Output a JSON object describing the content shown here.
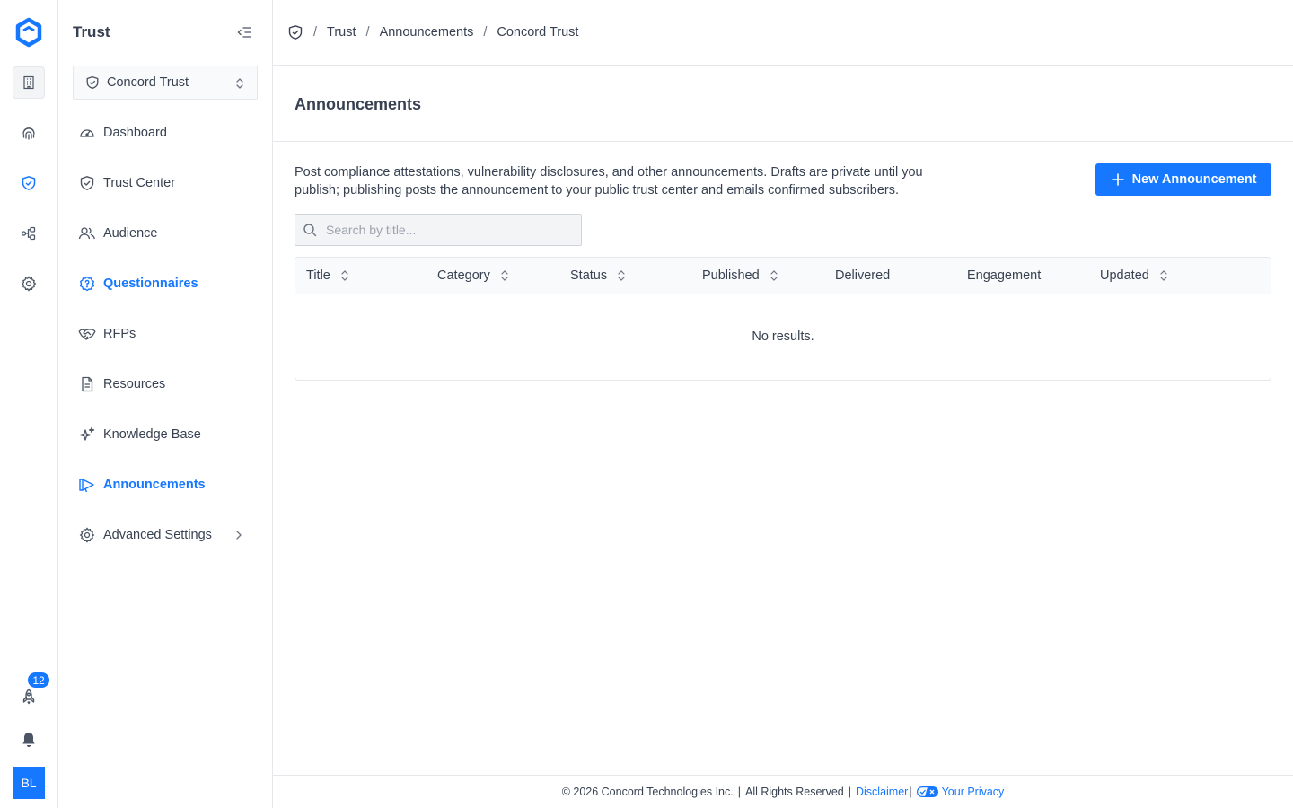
{
  "rail": {
    "items": [
      {
        "name": "building-icon"
      },
      {
        "name": "fingerprint-icon"
      },
      {
        "name": "shield-check-icon"
      },
      {
        "name": "workflow-icon"
      },
      {
        "name": "settings-icon"
      }
    ],
    "notification_count": "12",
    "avatar_initials": "BL"
  },
  "sidebar": {
    "title": "Trust",
    "selector_value": "Concord Trust",
    "items": [
      {
        "label": "Dashboard",
        "icon": "gauge-icon"
      },
      {
        "label": "Trust Center",
        "icon": "shield-check-icon"
      },
      {
        "label": "Audience",
        "icon": "users-icon"
      },
      {
        "label": "Questionnaires",
        "icon": "question-badge-icon"
      },
      {
        "label": "RFPs",
        "icon": "handshake-icon"
      },
      {
        "label": "Resources",
        "icon": "file-text-icon"
      },
      {
        "label": "Knowledge Base",
        "icon": "sparkles-icon"
      },
      {
        "label": "Announcements",
        "icon": "megaphone-icon"
      },
      {
        "label": "Advanced Settings",
        "icon": "settings-icon"
      }
    ]
  },
  "breadcrumb": [
    "Trust",
    "Announcements",
    "Concord Trust"
  ],
  "page": {
    "title": "Announcements",
    "description": "Post compliance attestations, vulnerability disclosures, and other announcements. Drafts are private until you publish; publishing posts the announcement to your public trust center and emails confirmed subscribers.",
    "new_button": "New Announcement",
    "search_placeholder": "Search by title..."
  },
  "table": {
    "columns": [
      "Title",
      "Category",
      "Status",
      "Published",
      "Delivered",
      "Engagement",
      "Updated"
    ],
    "empty_text": "No results."
  },
  "footer": {
    "copyright": "© 2026 Concord Technologies Inc.",
    "rights": "All Rights Reserved",
    "disclaimer": "Disclaimer",
    "privacy": "Your Privacy"
  },
  "colors": {
    "accent": "#1677ff",
    "border": "#e5e7eb",
    "text": "#374151"
  }
}
